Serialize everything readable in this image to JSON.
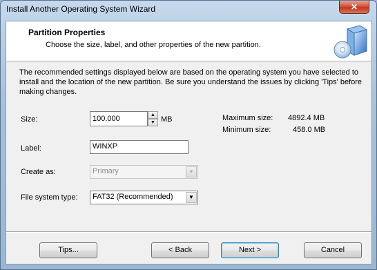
{
  "window": {
    "title": "Install Another Operating System Wizard",
    "close_glyph": "✕"
  },
  "header": {
    "title": "Partition Properties",
    "subtitle": "Choose the size, label, and other properties of the new partition.",
    "icon": "cd-disk-icon"
  },
  "description": "The recommended settings displayed below are based on the operating system you have selected to install and the location of the new partition. Be sure you understand the issues by clicking 'Tips' before making changes.",
  "form": {
    "size_label": "Size:",
    "size_value": "100.000",
    "size_unit": "MB",
    "max_size_label": "Maximum size:",
    "max_size_value": "4892.4 MB",
    "min_size_label": "Minimum size:",
    "min_size_value": "458.0 MB",
    "label_label": "Label:",
    "label_value": "WINXP",
    "create_as_label": "Create as:",
    "create_as_value": "Primary",
    "fs_type_label": "File system type:",
    "fs_type_value": "FAT32 (Recommended)"
  },
  "buttons": {
    "tips": "Tips...",
    "back": "< Back",
    "next": "Next >",
    "cancel": "Cancel"
  }
}
